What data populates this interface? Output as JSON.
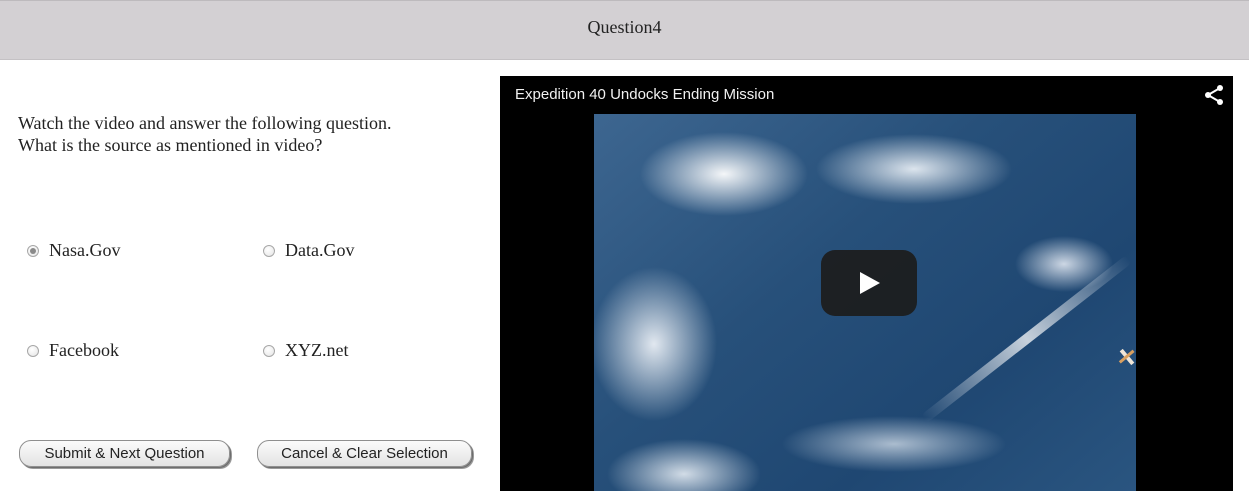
{
  "header": {
    "title": "Question4"
  },
  "question": {
    "line1": "Watch the video and answer the following question.",
    "line2": "What is the source as mentioned in video?"
  },
  "options": [
    {
      "label": "Nasa.Gov",
      "selected": true
    },
    {
      "label": "Data.Gov",
      "selected": false
    },
    {
      "label": "Facebook",
      "selected": false
    },
    {
      "label": "XYZ.net",
      "selected": false
    }
  ],
  "buttons": {
    "submit_label": "Submit & Next Question",
    "cancel_label": "Cancel & Clear Selection"
  },
  "video": {
    "title": "Expedition 40 Undocks Ending Mission",
    "share_icon": "share-icon",
    "play_icon": "play-icon"
  },
  "colors": {
    "header_bg": "#d3d0d3",
    "video_bg": "#000000",
    "play_button_bg": "#1c1c1c"
  }
}
